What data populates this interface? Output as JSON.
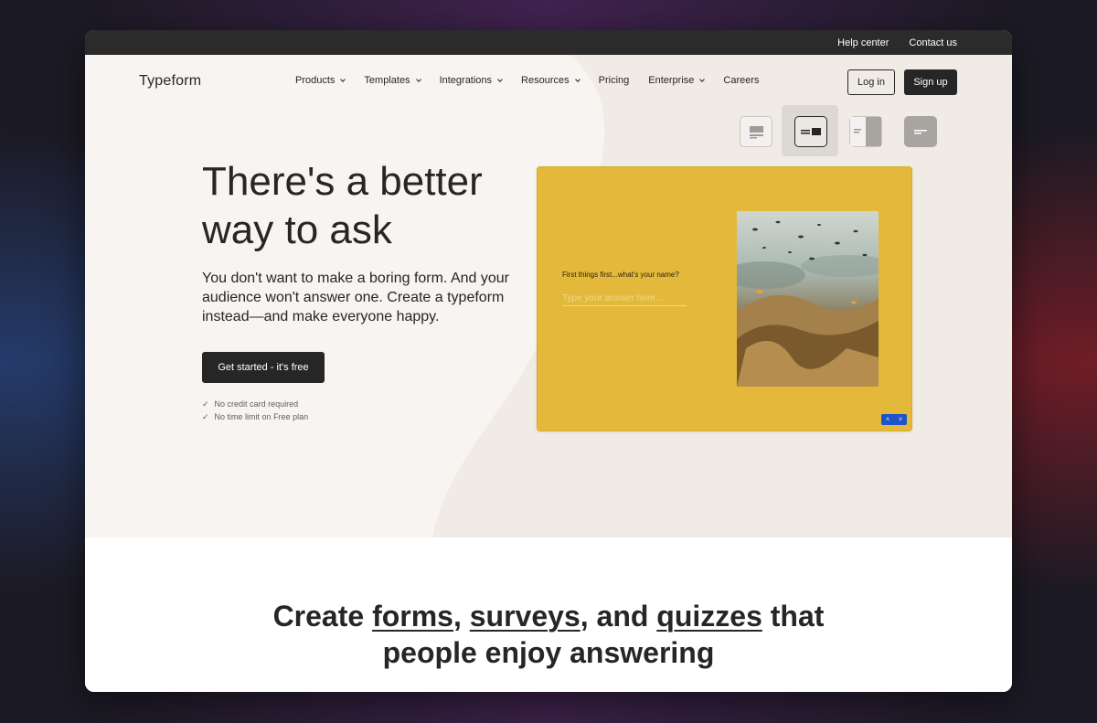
{
  "topbar": {
    "help_center": "Help center",
    "contact_us": "Contact us"
  },
  "nav": {
    "logo": "Typeform",
    "items": [
      {
        "label": "Products",
        "has_dropdown": true
      },
      {
        "label": "Templates",
        "has_dropdown": true
      },
      {
        "label": "Integrations",
        "has_dropdown": true
      },
      {
        "label": "Resources",
        "has_dropdown": true
      },
      {
        "label": "Pricing",
        "has_dropdown": false
      },
      {
        "label": "Enterprise",
        "has_dropdown": true
      },
      {
        "label": "Careers",
        "has_dropdown": false
      }
    ],
    "login": "Log in",
    "signup": "Sign up"
  },
  "layout_options": [
    {
      "icon": "layout-stack-icon",
      "active": false
    },
    {
      "icon": "layout-split-icon",
      "active": true
    },
    {
      "icon": "layout-float-right-icon",
      "active": false
    },
    {
      "icon": "layout-wallpaper-icon",
      "active": false
    }
  ],
  "hero": {
    "title": "There's a better way to ask",
    "subtitle": "You don't want to make a boring form. And your audience won't answer one. Create a typeform instead—and make everyone happy.",
    "cta": "Get started - it's free",
    "checks": [
      "No credit card required",
      "No time limit on Free plan"
    ]
  },
  "form_preview": {
    "question": "First things first...what's your name?",
    "placeholder": "Type your answer here...",
    "nav_up": "˄",
    "nav_down": "˅",
    "background_color": "#e4b93b",
    "nav_color": "#1f53c9"
  },
  "section": {
    "line1_before": "Create ",
    "forms": "forms",
    "comma1": ", ",
    "surveys": "surveys",
    "and": ", and ",
    "quizzes": "quizzes",
    "line1_after": " that",
    "line2": "people enjoy answering"
  },
  "colors": {
    "dark": "#262627",
    "hero_bg": "#f7f4f1",
    "topbar": "#2b2b2b"
  }
}
